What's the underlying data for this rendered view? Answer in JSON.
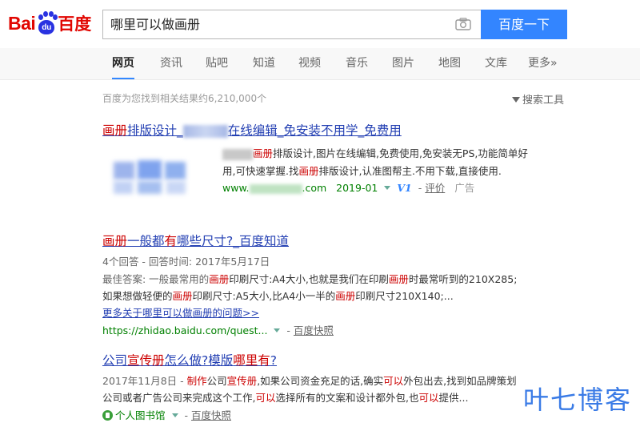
{
  "logo": {
    "latin": "Bai",
    "paw_text": "du",
    "chinese": "百度"
  },
  "search": {
    "query": "哪里可以做画册",
    "button": "百度一下"
  },
  "nav": [
    {
      "label": "网页",
      "active": true
    },
    {
      "label": "资讯"
    },
    {
      "label": "贴吧"
    },
    {
      "label": "知道"
    },
    {
      "label": "视频"
    },
    {
      "label": "音乐"
    },
    {
      "label": "图片"
    },
    {
      "label": "地图"
    },
    {
      "label": "文库"
    },
    {
      "label": "更多»"
    }
  ],
  "stats": "百度为您找到相关结果约6,210,000个",
  "tools": "搜索工具",
  "results": [
    {
      "title_hl": "画册",
      "title_a": "排版设计_",
      "title_b": "在线编辑_免安装不用学_免费用",
      "desc1_hl": "画册",
      "desc1_rest": "排版设计,图片在线编辑,免费使用,免安装无PS,功能简单好",
      "desc2_a": "用,可快速掌握.找",
      "desc2_hl": "画册",
      "desc2_b": "排版设计,认准图帮主.不用下载,直接使用.",
      "url_a": "www.",
      "url_b": ".com",
      "date": "2019-01",
      "v1": "V1",
      "rating": "评价",
      "ad": "广告"
    },
    {
      "title_hl1": "画册",
      "title_a": "一般都",
      "title_hl2": "有",
      "title_b": "哪些尺寸?_百度知道",
      "meta": "4个回答 - 回答时间: 2017年5月17日",
      "ans1_a": "最佳答案: 一般最常用的",
      "ans1_hl1": "画册",
      "ans1_b": "印刷尺寸:A4大小,也就是我们在印刷",
      "ans1_hl2": "画册",
      "ans1_c": "时最常听到的210X285;",
      "ans2_a": "如果想做轻便的",
      "ans2_hl1": "画册",
      "ans2_b": "印刷尺寸:A5大小,比A4小一半的",
      "ans2_hl2": "画册",
      "ans2_c": "印刷尺寸210X140;...",
      "more": "更多关于哪里可以做画册的问题>>",
      "url": "https://zhidao.baidu.com/quest...",
      "snapshot": "百度快照"
    },
    {
      "title_a": "公司",
      "title_hl1": "宣传册",
      "title_b": "怎么做?模版",
      "title_hl2": "哪里有",
      "title_c": "?",
      "d1_date": "2017年11月8日 - ",
      "d1_hl1": "制作",
      "d1_a": "公司",
      "d1_hl2": "宣传册",
      "d1_b": ",如果公司资金充足的话,确实",
      "d1_hl3": "可以",
      "d1_c": "外包出去,找到如品牌策划",
      "d2_a": "公司或者广告公司来完成这个工作,",
      "d2_hl1": "可以",
      "d2_b": "选择所有的文案和设计都外包,也",
      "d2_hl2": "可以",
      "d2_c": "提供...",
      "source": "个人图书馆",
      "snapshot": "百度快照"
    }
  ],
  "watermark": "叶七博客"
}
